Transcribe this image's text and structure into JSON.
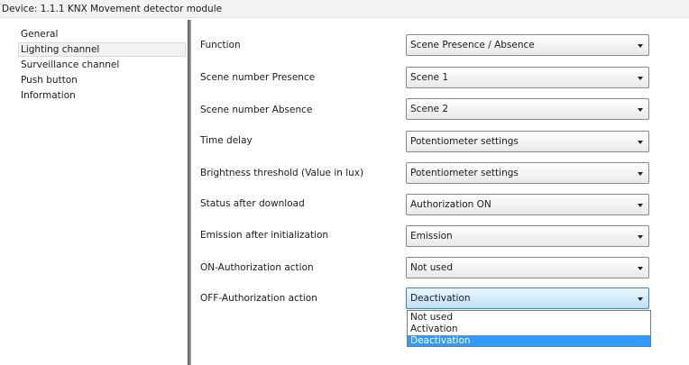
{
  "device_title": "Device: 1.1.1  KNX Movement detector module",
  "sidebar": {
    "items": [
      {
        "label": "General"
      },
      {
        "label": "Lighting channel",
        "selected": true
      },
      {
        "label": "Surveillance channel"
      },
      {
        "label": "Push button"
      },
      {
        "label": "Information"
      }
    ]
  },
  "params": [
    {
      "label": "Function",
      "value": "Scene Presence / Absence"
    },
    {
      "label": "Scene number Presence",
      "value": "Scene 1"
    },
    {
      "label": "Scene number Absence",
      "value": "Scene 2"
    },
    {
      "label": "Time delay",
      "value": "Potentiometer settings"
    },
    {
      "label": "Brightness threshold (Value in lux)",
      "value": "Potentiometer settings"
    },
    {
      "label": "Status after download",
      "value": "Authorization ON"
    },
    {
      "label": "Emission after initialization",
      "value": "Emission"
    },
    {
      "label": "ON-Authorization action",
      "value": "Not used"
    },
    {
      "label": "OFF-Authorization action",
      "value": "Deactivation",
      "open": true
    }
  ],
  "dropdown": {
    "options": [
      "Not used",
      "Activation",
      "Deactivation"
    ],
    "highlighted_option": "Deactivation"
  },
  "colors": {
    "highlight": "#3399ff",
    "active_combo": "#bfe0f7",
    "separator": "#7b7b7b"
  }
}
